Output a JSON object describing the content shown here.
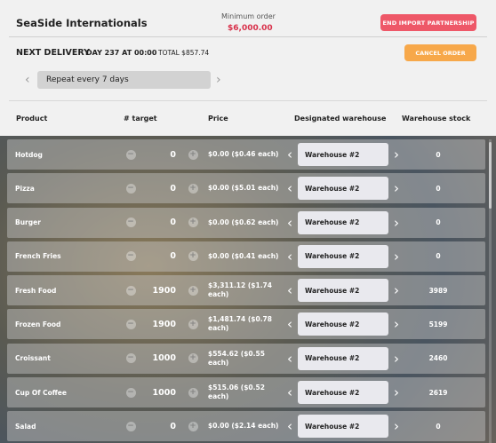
{
  "header": {
    "company": "SeaSide Internationals",
    "min_order_label": "Minimum order",
    "min_order_value": "$6,000.00",
    "end_partnership": "END IMPORT PARTNERSHIP",
    "next_delivery_label": "NEXT DELIVERY",
    "delivery_day": "DAY 237 AT 00:00",
    "delivery_total": "TOTAL $857.74",
    "cancel_order": "CANCEL ORDER",
    "repeat_label": "Repeat every 7 days"
  },
  "columns": {
    "product": "Product",
    "target": "# target",
    "price": "Price",
    "warehouse": "Designated warehouse",
    "stock": "Warehouse stock"
  },
  "rows": [
    {
      "product": "Hotdog",
      "target": "0",
      "price": "$0.00 ($0.46 each)",
      "warehouse": "Warehouse #2",
      "stock": "0"
    },
    {
      "product": "Pizza",
      "target": "0",
      "price": "$0.00 ($5.01 each)",
      "warehouse": "Warehouse #2",
      "stock": "0"
    },
    {
      "product": "Burger",
      "target": "0",
      "price": "$0.00 ($0.62 each)",
      "warehouse": "Warehouse #2",
      "stock": "0"
    },
    {
      "product": "French Fries",
      "target": "0",
      "price": "$0.00 ($0.41 each)",
      "warehouse": "Warehouse #2",
      "stock": "0"
    },
    {
      "product": "Fresh Food",
      "target": "1900",
      "price": "$3,311.12 ($1.74 each)",
      "warehouse": "Warehouse #2",
      "stock": "3989"
    },
    {
      "product": "Frozen Food",
      "target": "1900",
      "price": "$1,481.74 ($0.78 each)",
      "warehouse": "Warehouse #2",
      "stock": "5199"
    },
    {
      "product": "Croissant",
      "target": "1000",
      "price": "$554.62 ($0.55 each)",
      "warehouse": "Warehouse #2",
      "stock": "2460"
    },
    {
      "product": "Cup Of Coffee",
      "target": "1000",
      "price": "$515.06 ($0.52 each)",
      "warehouse": "Warehouse #2",
      "stock": "2619"
    },
    {
      "product": "Salad",
      "target": "0",
      "price": "$0.00 ($2.14 each)",
      "warehouse": "Warehouse #2",
      "stock": "0"
    }
  ],
  "icons": {
    "minus": "−",
    "plus": "+",
    "left": "‹",
    "right": "›"
  },
  "colors": {
    "end_button": "#ee5868",
    "cancel_button": "#f7a84a",
    "min_value": "#d8304a"
  }
}
